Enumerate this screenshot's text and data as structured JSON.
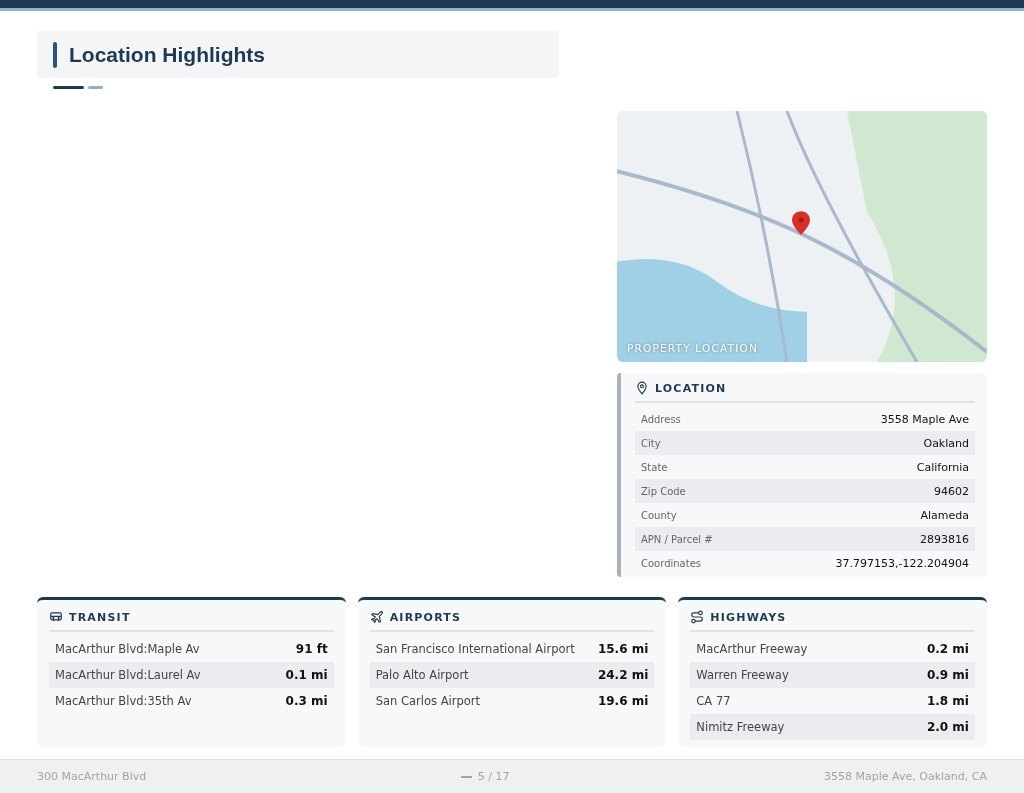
{
  "header": {
    "title": "Location Highlights"
  },
  "map": {
    "caption": "PROPERTY LOCATION"
  },
  "location": {
    "title": "LOCATION",
    "rows": [
      {
        "label": "Address",
        "value": "3558 Maple Ave"
      },
      {
        "label": "City",
        "value": "Oakland"
      },
      {
        "label": "State",
        "value": "California"
      },
      {
        "label": "Zip Code",
        "value": "94602"
      },
      {
        "label": "County",
        "value": "Alameda"
      },
      {
        "label": "APN / Parcel #",
        "value": "2893816"
      },
      {
        "label": "Coordinates",
        "value": "37.797153,-122.204904"
      }
    ]
  },
  "cards": [
    {
      "kind": "transit",
      "title": "TRANSIT",
      "rows": [
        {
          "name": "MacArthur Blvd:Maple Av",
          "distance": "91 ft"
        },
        {
          "name": "MacArthur Blvd:Laurel Av",
          "distance": "0.1 mi"
        },
        {
          "name": "MacArthur Blvd:35th Av",
          "distance": "0.3 mi"
        }
      ]
    },
    {
      "kind": "airports",
      "title": "AIRPORTS",
      "rows": [
        {
          "name": "San Francisco International Airport",
          "distance": "15.6 mi"
        },
        {
          "name": "Palo Alto Airport",
          "distance": "24.2 mi"
        },
        {
          "name": "San Carlos Airport",
          "distance": "19.6 mi"
        }
      ]
    },
    {
      "kind": "highways",
      "title": "HIGHWAYS",
      "rows": [
        {
          "name": "MacArthur Freeway",
          "distance": "0.2 mi"
        },
        {
          "name": "Warren Freeway",
          "distance": "0.9 mi"
        },
        {
          "name": "CA 77",
          "distance": "1.8 mi"
        },
        {
          "name": "Nimitz Freeway",
          "distance": "2.0 mi"
        }
      ]
    }
  ],
  "footer": {
    "left": "300 MacArthur Blvd",
    "page": "5 / 17",
    "right": "3558 Maple Ave, Oakland, CA"
  }
}
